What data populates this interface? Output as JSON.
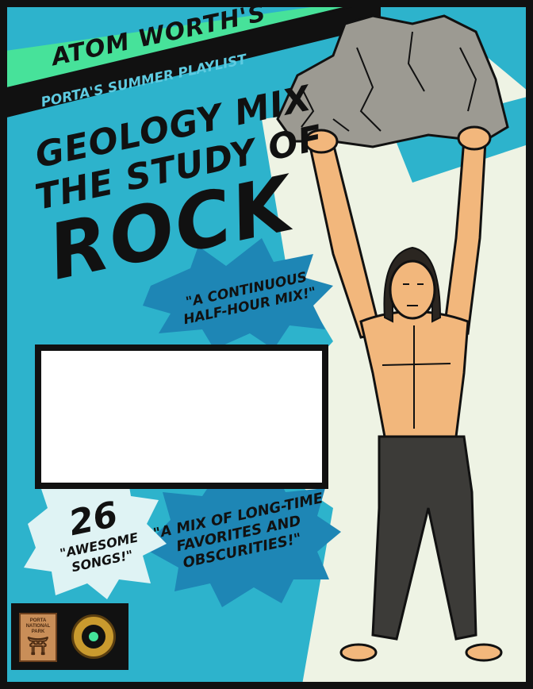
{
  "poster": {
    "brand": "ATOM WORTH'S",
    "subtitle": "PORTA'S SUMMER PLAYLIST",
    "title_line1": "GEOLOGY MIX",
    "title_line2": "THE STUDY OF",
    "title_line3": "ROCK",
    "burst_continuous_line1": "\"A CONTINUOUS",
    "burst_continuous_line2": "HALF-HOUR MIX!\"",
    "burst_count_number": "26",
    "burst_count_line1": "\"AWESOME",
    "burst_count_line2": "SONGS!\"",
    "burst_mix_line1": "\"A MIX OF LONG-TIME",
    "burst_mix_line2": "FAVORITES AND",
    "burst_mix_line3": "OBSCURITIES!\"",
    "badge_line1": "PORTA",
    "badge_line2": "NATIONAL",
    "badge_line3": "PARK"
  },
  "colors": {
    "sky": "#2db3cc",
    "band_green": "#47e29a",
    "burst_dark": "#1e86b5",
    "burst_light": "#dff3f4",
    "rock": "#9c9a92",
    "skin": "#f2b77c",
    "pants": "#3c3b38"
  },
  "icons": {
    "park_badge": "picnic-table-icon",
    "record": "vinyl-record-icon"
  }
}
